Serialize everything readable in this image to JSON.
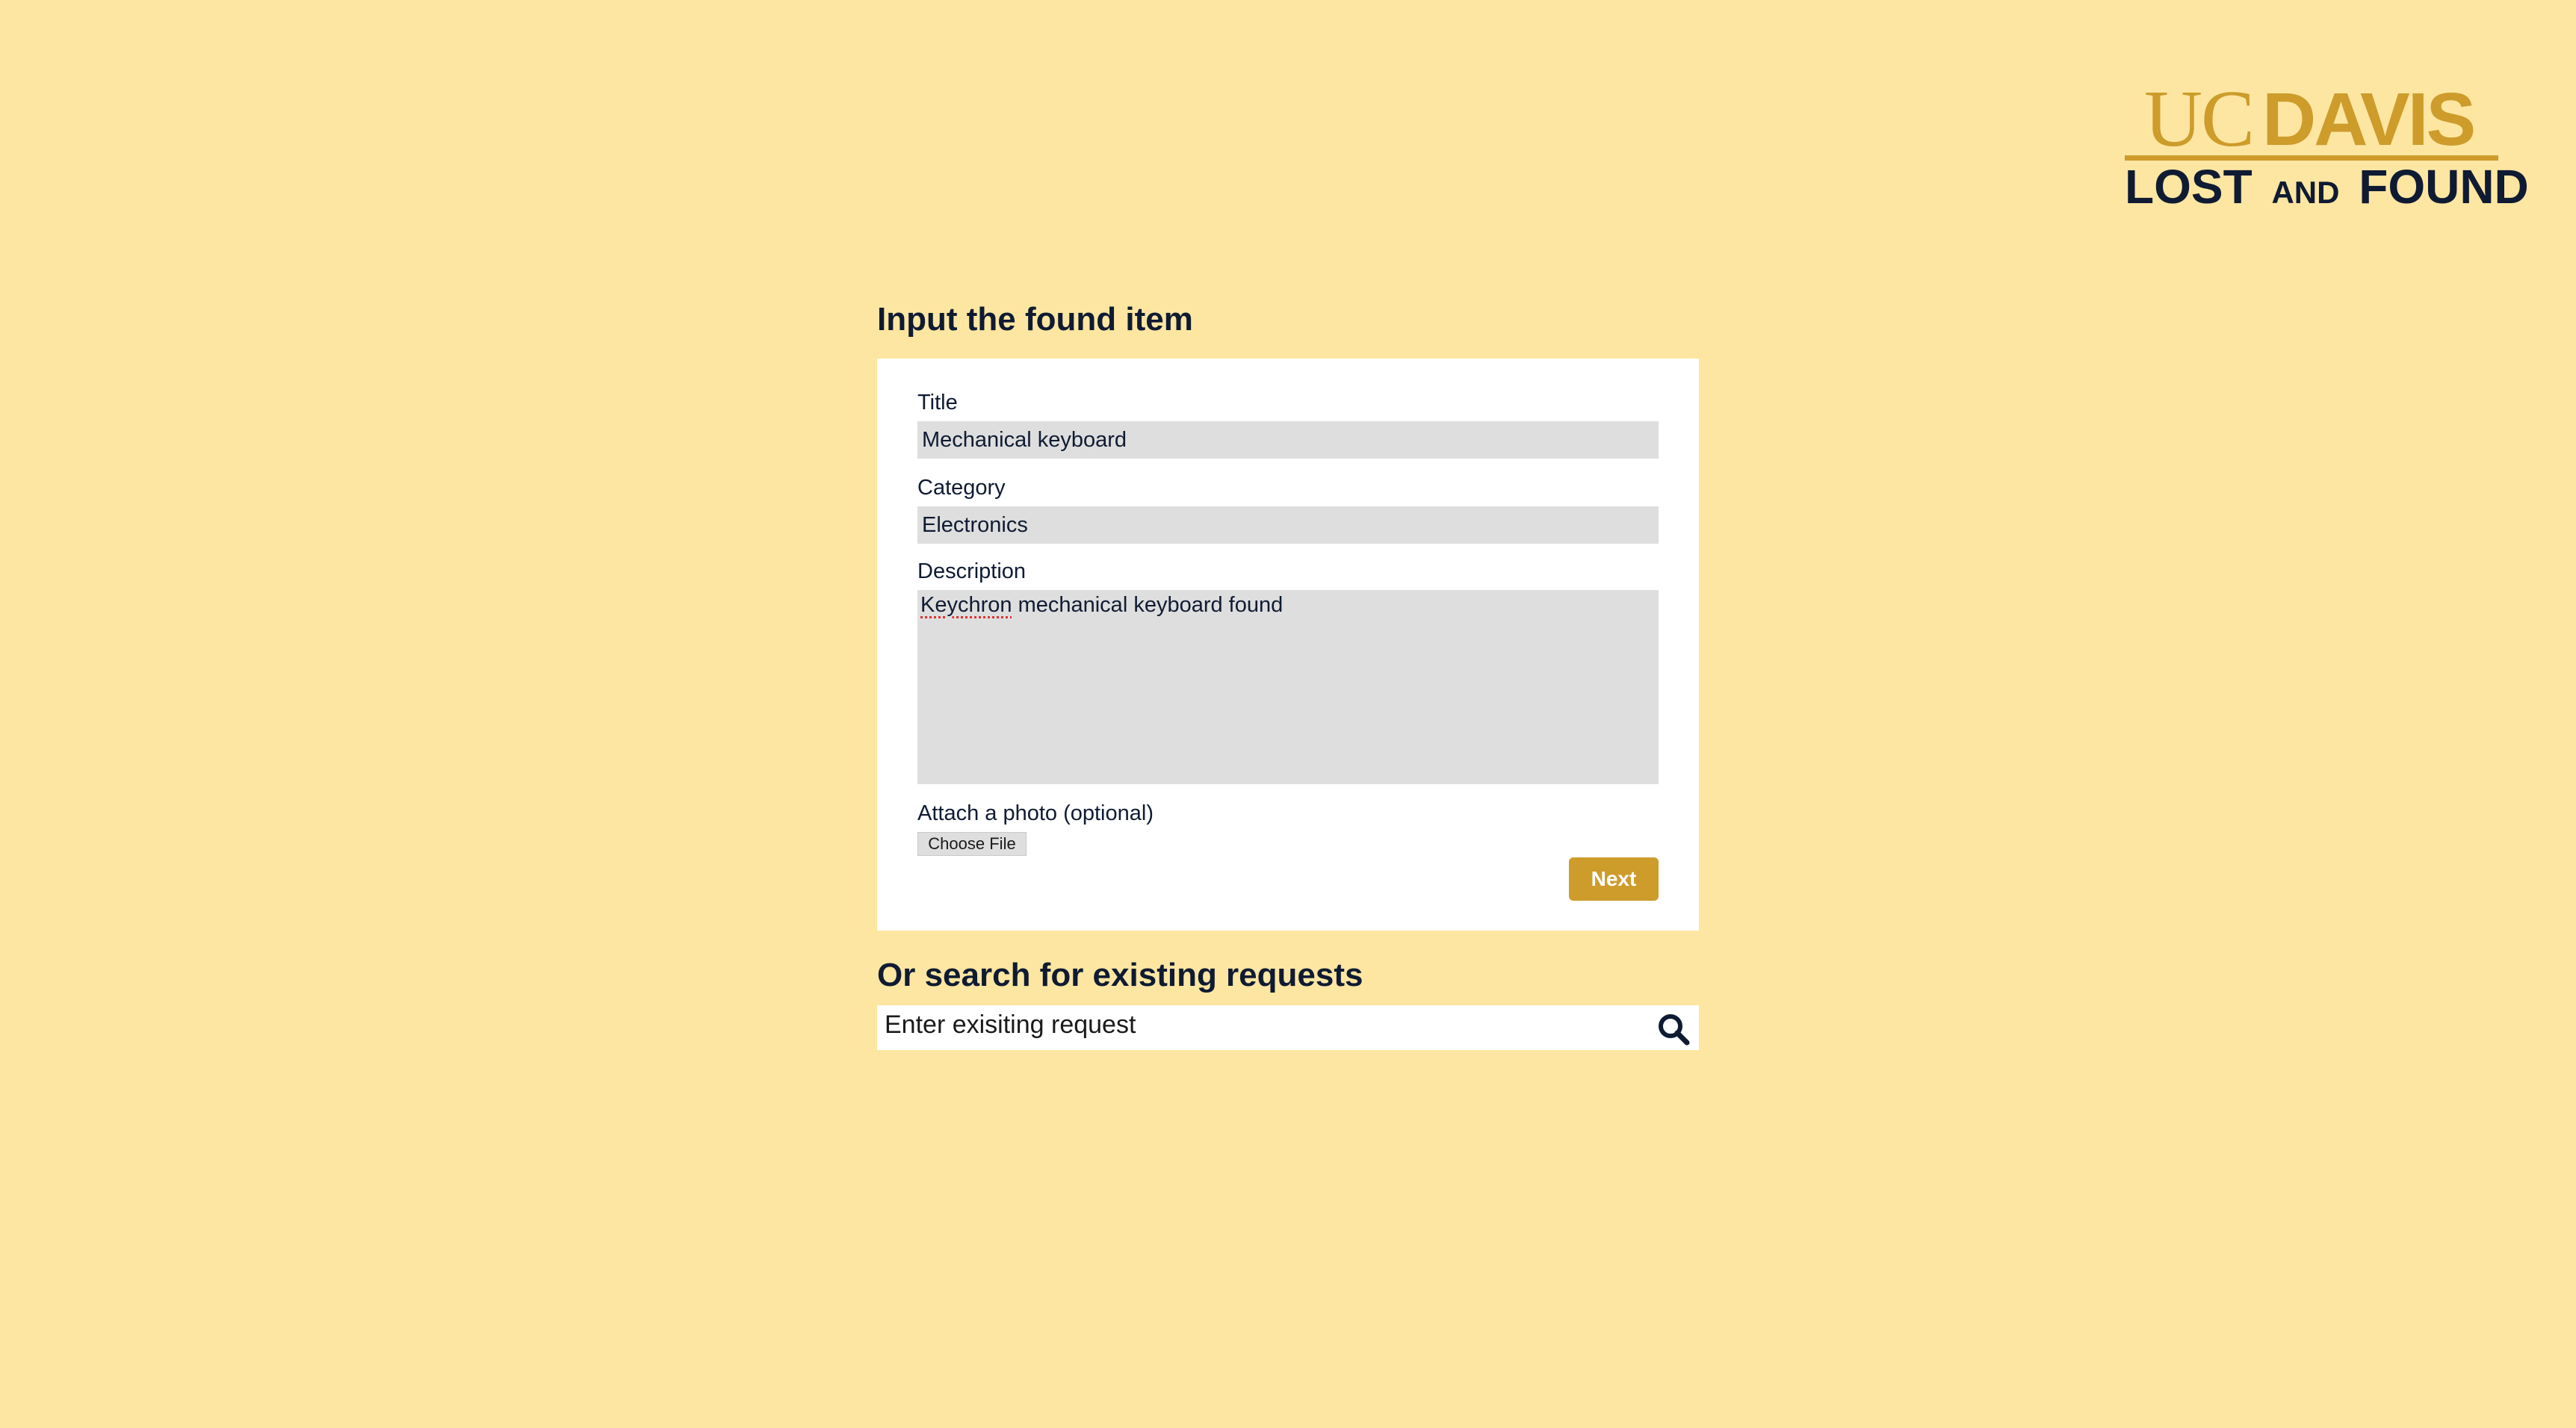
{
  "brand": {
    "uc": "UC",
    "davis": "DAVIS",
    "lost": "LOST",
    "and": "AND",
    "found": "FOUND",
    "gold": "#cd9c2b",
    "navy": "#0f1b33",
    "background": "#fde6a1"
  },
  "form": {
    "heading": "Input the found item",
    "title_label": "Title",
    "title_value": "Mechanical keyboard",
    "category_label": "Category",
    "category_value": "Electronics",
    "description_label": "Description",
    "description_misspelled_word": "Keychron",
    "description_rest": " mechanical keyboard found",
    "photo_label": "Attach a photo (optional)",
    "file_button_label": "Choose File",
    "next_label": "Next"
  },
  "search": {
    "heading": "Or search for existing requests",
    "placeholder": "Enter exisiting request",
    "icon": "search-icon"
  }
}
